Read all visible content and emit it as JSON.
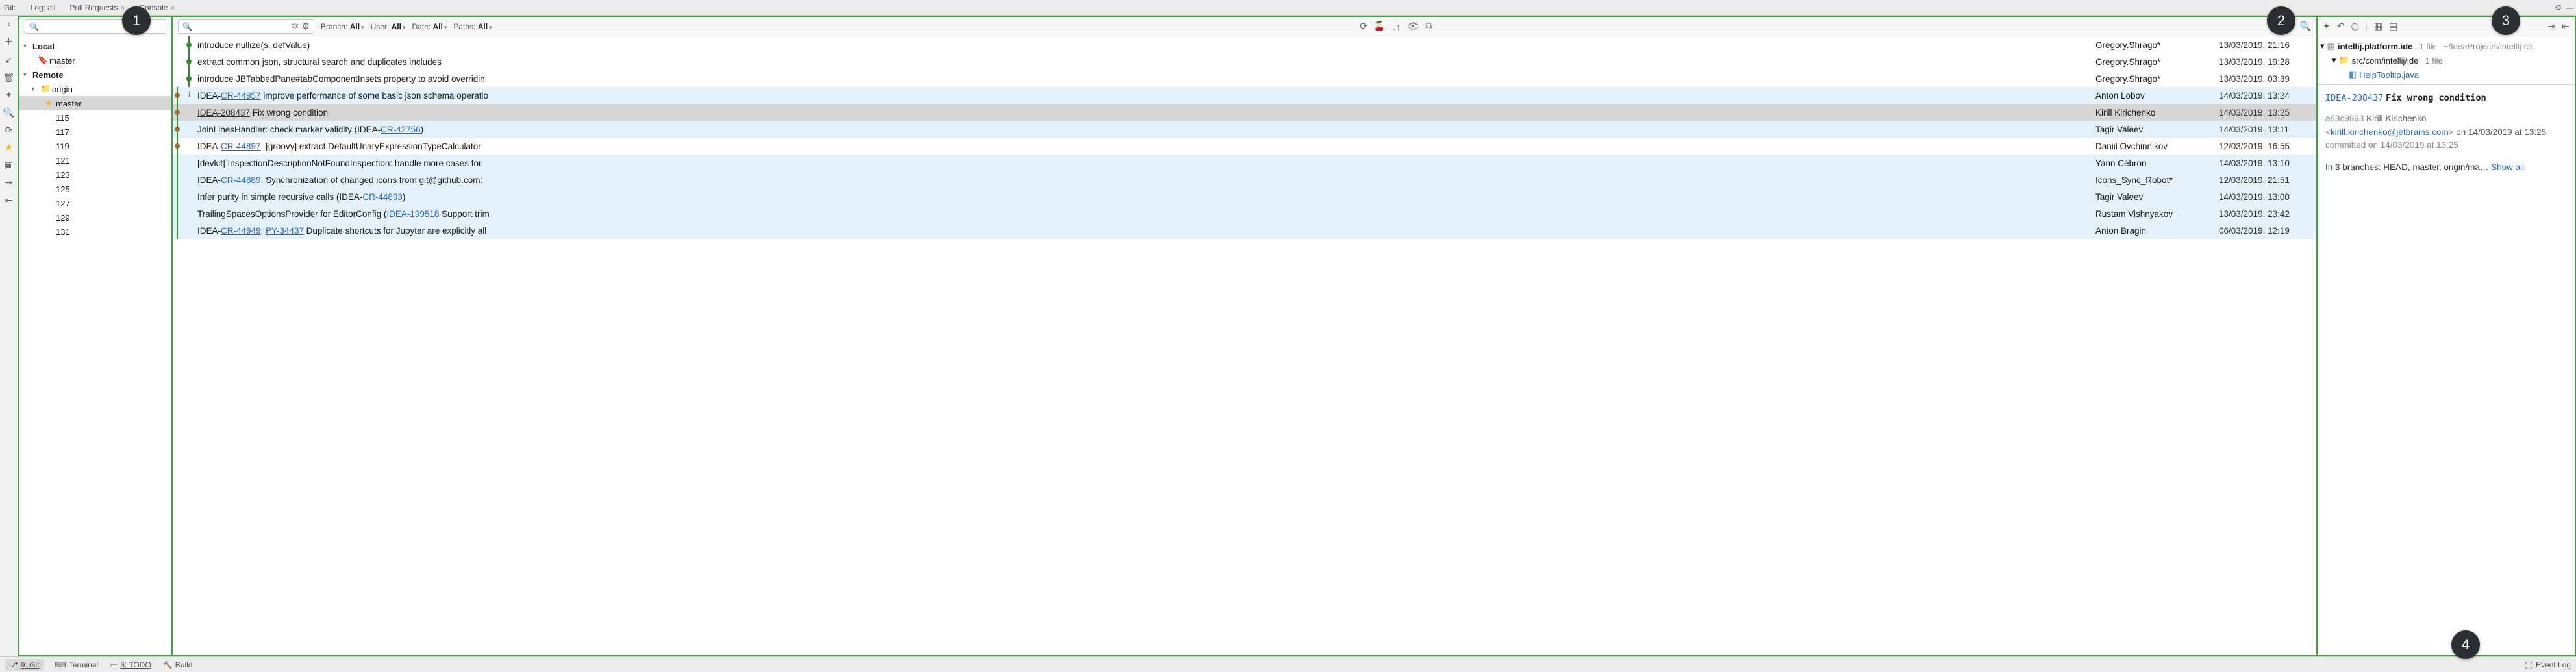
{
  "toolwindow_tabs": {
    "prefix": "Git:",
    "log": "Log: all",
    "pr": "Pull Requests",
    "console": "Console"
  },
  "callouts": {
    "b1": "1",
    "b2": "2",
    "b3": "3",
    "b4": "4"
  },
  "branches": {
    "local_label": "Local",
    "local_master": "master",
    "remote_label": "Remote",
    "origin_label": "origin",
    "origin_master": "master",
    "refs": [
      "115",
      "117",
      "119",
      "121",
      "123",
      "125",
      "127",
      "129",
      "131"
    ]
  },
  "log_filters": {
    "branch_lbl": "Branch:",
    "branch_val": "All",
    "user_lbl": "User:",
    "user_val": "All",
    "date_lbl": "Date:",
    "date_val": "All",
    "paths_lbl": "Paths:",
    "paths_val": "All"
  },
  "commits": [
    {
      "dot": "#2e8b2e",
      "line": 24,
      "msg_pre": "introduce nullize(s, defValue)",
      "author": "Gregory.Shrago*",
      "date": "13/03/2019, 21:16"
    },
    {
      "dot": "#2e8b2e",
      "line": 24,
      "msg_pre": "extract common json, structural search and duplicates includes",
      "author": "Gregory.Shrago*",
      "date": "13/03/2019, 19:28"
    },
    {
      "dot": "#2e8b2e",
      "line": 24,
      "msg_pre": "introduce JBTabbedPane#tabComponentInsets property to avoid overridin",
      "author": "Gregory.Shrago*",
      "date": "13/03/2019, 03:39"
    },
    {
      "dot": "#917340",
      "line": 6,
      "ctx": true,
      "msg_pre": "IDEA-",
      "link": "CR-44957",
      "msg_post": " improve performance of some basic json schema operatio",
      "author": "Anton Lobov",
      "date": "14/03/2019, 13:24",
      "arrow": true
    },
    {
      "dot": "#917340",
      "line": 6,
      "sel": true,
      "msg_pre": "",
      "ulink": "IDEA-208437",
      "msg_post": " Fix wrong condition",
      "author": "Kirill Kirichenko",
      "date": "14/03/2019, 13:25"
    },
    {
      "dot": "#917340",
      "line": 6,
      "ctx": true,
      "msg_pre": "JoinLinesHandler: check marker validity (IDEA-",
      "link": "CR-42756",
      "msg_post": ")",
      "author": "Tagir Valeev",
      "date": "14/03/2019, 13:11"
    },
    {
      "dot": "#917340",
      "line": 6,
      "msg_pre": "IDEA-",
      "link": "CR-44897",
      "msg_post": ": [groovy] extract DefaultUnaryExpressionTypeCalculator",
      "author": "Daniil Ovchinnikov",
      "date": "12/03/2019, 16:55"
    },
    {
      "line": 6,
      "ctx": true,
      "msg_pre": "[devkit] InspectionDescriptionNotFoundInspection: handle more cases for",
      "author": "Yann Cébron",
      "date": "14/03/2019, 13:10"
    },
    {
      "line": 6,
      "ctx": true,
      "msg_pre": "IDEA-",
      "link": "CR-44889",
      "msg_post": ": Synchronization of changed icons from git@github.com:",
      "author": "Icons_Sync_Robot*",
      "date": "12/03/2019, 21:51"
    },
    {
      "line": 6,
      "ctx": true,
      "msg_pre": "Infer purity in simple recursive calls (IDEA-",
      "link": "CR-44893",
      "msg_post": ")",
      "author": "Tagir Valeev",
      "date": "14/03/2019, 13:00"
    },
    {
      "line": 6,
      "ctx": true,
      "msg_pre": "TrailingSpacesOptionsProvider for EditorConfig (",
      "link": "IDEA-199518",
      "msg_post": " Support trim",
      "author": "Rustam Vishnyakov",
      "date": "13/03/2019, 23:42"
    },
    {
      "line": 6,
      "ctx": true,
      "msg_pre": "IDEA-",
      "link": "CR-44949",
      "msg_post": ": ",
      "link2": "PY-34437",
      "msg_post2": " Duplicate shortcuts for Jupyter are explicitly all",
      "author": "Anton Bragin",
      "date": "06/03/2019, 12:19"
    }
  ],
  "changed_files": {
    "root": "intellij.platform.ide",
    "root_cnt": "1 file",
    "root_path": "~/IdeaProjects/intellij-co",
    "dir": "src/com/intellij/ide",
    "dir_cnt": "1 file",
    "file": "HelpTooltip.java"
  },
  "commit_detail": {
    "issue": "IDEA-208437",
    "title": "Fix wrong condition",
    "hash": "a93c9893",
    "author": "Kirill Kirichenko",
    "email": "kirill.kirichenko@jetbrains.com",
    "on": " on 14/03/2019 at 13:25",
    "committed": "committed on 14/03/2019 at 13:25",
    "branches_pre": "In 3 branches: HEAD, master, origin/ma… ",
    "show_all": "Show all"
  },
  "statusbar": {
    "git": "9: Git",
    "terminal": "Terminal",
    "todo": "6: TODO",
    "build": "Build",
    "eventlog": "Event Log"
  }
}
